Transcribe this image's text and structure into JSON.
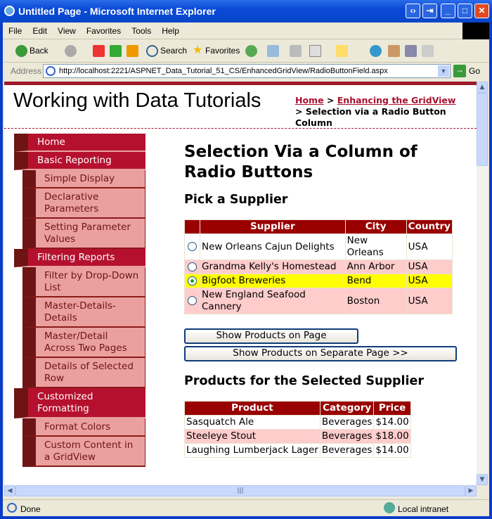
{
  "window": {
    "title": "Untitled Page - Microsoft Internet Explorer"
  },
  "menu": [
    "File",
    "Edit",
    "View",
    "Favorites",
    "Tools",
    "Help"
  ],
  "toolbar": {
    "back": "Back",
    "search": "Search",
    "favorites": "Favorites"
  },
  "address": {
    "label": "Address",
    "url": "http://localhost:2221/ASPNET_Data_Tutorial_51_CS/EnhancedGridView/RadioButtonField.aspx",
    "go": "Go"
  },
  "site": {
    "title": "Working with Data Tutorials"
  },
  "breadcrumb": {
    "home": "Home",
    "sep": ">",
    "parent": "Enhancing the GridView",
    "current": "> Selection via a Radio Button Column"
  },
  "sidebar": [
    {
      "label": "Home",
      "type": "section"
    },
    {
      "label": "Basic Reporting",
      "type": "section"
    },
    {
      "label": "Simple Display",
      "type": "sub"
    },
    {
      "label": "Declarative Parameters",
      "type": "sub"
    },
    {
      "label": "Setting Parameter Values",
      "type": "sub"
    },
    {
      "label": "Filtering Reports",
      "type": "section"
    },
    {
      "label": "Filter by Drop-Down List",
      "type": "sub"
    },
    {
      "label": "Master-Details-Details",
      "type": "sub"
    },
    {
      "label": "Master/Detail Across Two Pages",
      "type": "sub"
    },
    {
      "label": "Details of Selected Row",
      "type": "sub"
    },
    {
      "label": "Customized Formatting",
      "type": "section"
    },
    {
      "label": "Format Colors",
      "type": "sub"
    },
    {
      "label": "Custom Content in a GridView",
      "type": "sub"
    }
  ],
  "main": {
    "heading": "Selection Via a Column of Radio Buttons",
    "pick_heading": "Pick a Supplier",
    "suppliers": {
      "headers": [
        "",
        "Supplier",
        "City",
        "Country"
      ],
      "rows": [
        {
          "supplier": "New Orleans Cajun Delights",
          "city": "New Orleans",
          "country": "USA",
          "selected": false
        },
        {
          "supplier": "Grandma Kelly's Homestead",
          "city": "Ann Arbor",
          "country": "USA",
          "selected": false
        },
        {
          "supplier": "Bigfoot Breweries",
          "city": "Bend",
          "country": "USA",
          "selected": true
        },
        {
          "supplier": "New England Seafood Cannery",
          "city": "Boston",
          "country": "USA",
          "selected": false
        }
      ]
    },
    "btn_on_page": "Show Products on Page",
    "btn_separate": "Show Products on Separate Page >>",
    "products_heading": "Products for the Selected Supplier",
    "products": {
      "headers": [
        "Product",
        "Category",
        "Price"
      ],
      "rows": [
        [
          "Sasquatch Ale",
          "Beverages",
          "$14.00"
        ],
        [
          "Steeleye Stout",
          "Beverages",
          "$18.00"
        ],
        [
          "Laughing Lumberjack Lager",
          "Beverages",
          "$14.00"
        ]
      ]
    }
  },
  "status": {
    "text": "Done",
    "zone": "Local intranet"
  },
  "colors": {
    "header": "#990000",
    "alt_row": "#ffcccc",
    "selected_row": "#ffff00",
    "sidebar_section": "#b5112f",
    "sidebar_sub": "#eba0a0"
  }
}
